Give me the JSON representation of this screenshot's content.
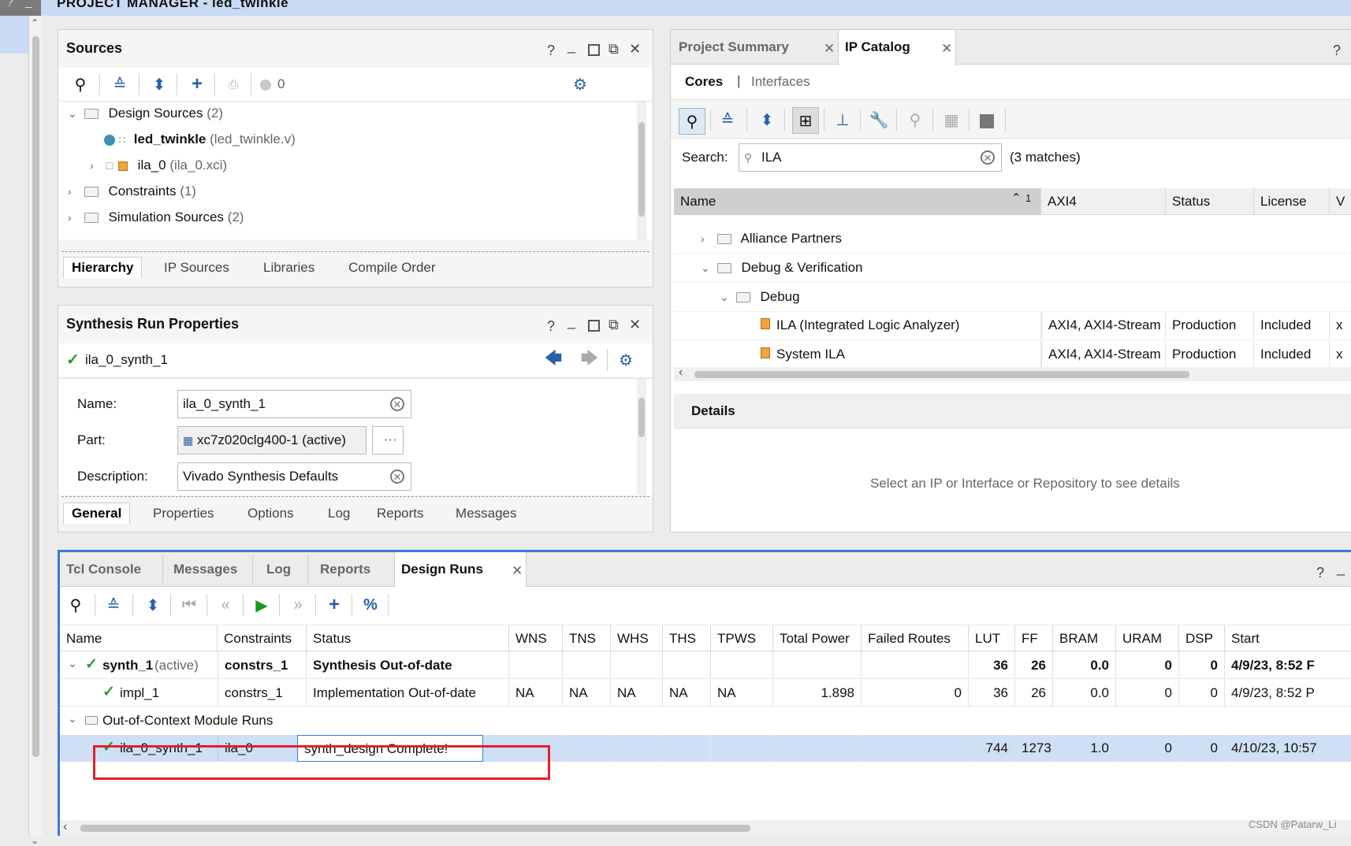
{
  "window": {
    "title": "PROJECT MANAGER - led_twinkle"
  },
  "sources": {
    "title": "Sources",
    "status_count": "0",
    "tree": {
      "design_sources": "Design Sources",
      "design_sources_count": "(2)",
      "led_twinkle": "led_twinkle",
      "led_twinkle_file": "(led_twinkle.v)",
      "ila_0": "ila_0",
      "ila_0_file": "(ila_0.xci)",
      "constraints": "Constraints",
      "constraints_count": "(1)",
      "simulation_sources": "Simulation Sources",
      "simulation_sources_count": "(2)"
    },
    "tabs": [
      "Hierarchy",
      "IP Sources",
      "Libraries",
      "Compile Order"
    ]
  },
  "synth_props": {
    "title": "Synthesis Run Properties",
    "run_name": "ila_0_synth_1",
    "name_label": "Name:",
    "name_value": "ila_0_synth_1",
    "part_label": "Part:",
    "part_value": "xc7z020clg400-1 (active)",
    "desc_label": "Description:",
    "desc_value": "Vivado Synthesis Defaults",
    "tabs": [
      "General",
      "Properties",
      "Options",
      "Log",
      "Reports",
      "Messages"
    ]
  },
  "ip_catalog": {
    "tabs": [
      "Project Summary",
      "IP Catalog"
    ],
    "subtabs": [
      "Cores",
      "Interfaces"
    ],
    "search_label": "Search:",
    "search_value": "ILA",
    "matches": "(3 matches)",
    "columns": [
      "Name",
      "AXI4",
      "Status",
      "License",
      "V"
    ],
    "sort_indicator": "1",
    "tree": {
      "alliance": "Alliance Partners",
      "debug_verif": "Debug & Verification",
      "debug": "Debug"
    },
    "rows": [
      {
        "name": "ILA (Integrated Logic Analyzer)",
        "axi4": "AXI4, AXI4-Stream",
        "status": "Production",
        "license": "Included",
        "v": "x"
      },
      {
        "name": "System ILA",
        "axi4": "AXI4, AXI4-Stream",
        "status": "Production",
        "license": "Included",
        "v": "x"
      }
    ],
    "details_title": "Details",
    "details_hint": "Select an IP or Interface or Repository to see details"
  },
  "bottom": {
    "tabs": [
      "Tcl Console",
      "Messages",
      "Log",
      "Reports",
      "Design Runs"
    ],
    "columns": [
      "Name",
      "Constraints",
      "Status",
      "WNS",
      "TNS",
      "WHS",
      "THS",
      "TPWS",
      "Total Power",
      "Failed Routes",
      "LUT",
      "FF",
      "BRAM",
      "URAM",
      "DSP",
      "Start"
    ],
    "synth": {
      "name": "synth_1",
      "active": "(active)",
      "constraints": "constrs_1",
      "status": "Synthesis Out-of-date",
      "lut": "36",
      "ff": "26",
      "bram": "0.0",
      "uram": "0",
      "dsp": "0",
      "start": "4/9/23, 8:52 F"
    },
    "impl": {
      "name": "impl_1",
      "constraints": "constrs_1",
      "status": "Implementation Out-of-date",
      "wns": "NA",
      "tns": "NA",
      "whs": "NA",
      "ths": "NA",
      "tpws": "NA",
      "power": "1.898",
      "failed": "0",
      "lut": "36",
      "ff": "26",
      "bram": "0.0",
      "uram": "0",
      "dsp": "0",
      "start": "4/9/23, 8:52 P"
    },
    "ooc_label": "Out-of-Context Module Runs",
    "ooc": {
      "name": "ila_0_synth_1",
      "constraints": "ila_0",
      "status": "synth_design Complete!",
      "lut": "744",
      "ff": "1273",
      "bram": "1.0",
      "uram": "0",
      "dsp": "0",
      "start": "4/10/23, 10:57"
    }
  },
  "watermark": "CSDN @Patarw_Li",
  "colors": {
    "accent": "#3a7bd5",
    "selection": "#cfe0f6",
    "highlight_box": "#e0222a",
    "check": "#2a9d2a",
    "run": "#1a9a1a",
    "gear": "#2b5fa8"
  }
}
